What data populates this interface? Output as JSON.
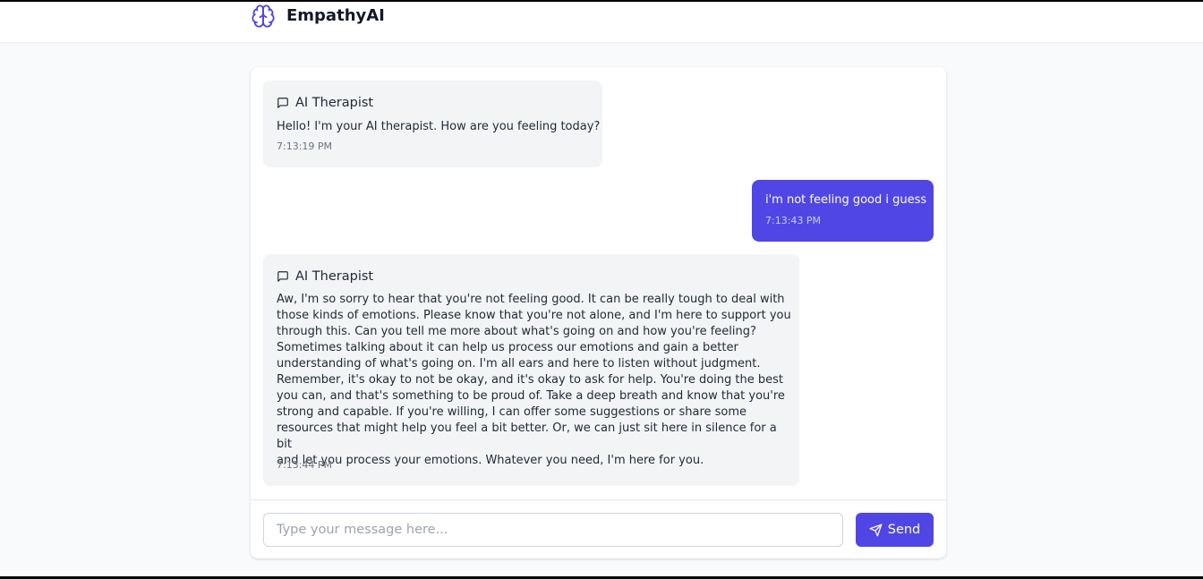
{
  "app": {
    "name": "EmpathyAI",
    "logo_icon": "brain-icon"
  },
  "colors": {
    "accent": "#4f46e5",
    "ai_bubble": "#f3f4f6",
    "page_bg": "#f9fafb"
  },
  "messages": [
    {
      "role": "ai",
      "sender": "AI Therapist",
      "icon": "message-square-icon",
      "text": "Hello! I'm your AI therapist. How are you feeling today?",
      "time": "7:13:19 PM"
    },
    {
      "role": "user",
      "text": "i'm not feeling good i guess",
      "time": "7:13:43 PM"
    },
    {
      "role": "ai",
      "sender": "AI Therapist",
      "icon": "message-square-icon",
      "text": "Aw, I'm so sorry to hear that you're not feeling good. It can be really tough to deal with\nthose kinds of emotions. Please know that you're not alone, and I'm here to support you\nthrough this. Can you tell me more about what's going on and how you're feeling?\nSometimes talking about it can help us process our emotions and gain a better\nunderstanding of what's going on. I'm all ears and here to listen without judgment.\nRemember, it's okay to not be okay, and it's okay to ask for help. You're doing the best\nyou can, and that's something to be proud of. Take a deep breath and know that you're\nstrong and capable. If you're willing, I can offer some suggestions or share some\nresources that might help you feel a bit better. Or, we can just sit here in silence for a bit\nand let you process your emotions. Whatever you need, I'm here for you.",
      "time": "7:13:44 PM"
    }
  ],
  "composer": {
    "value": "",
    "placeholder": "Type your message here...",
    "send_label": "Send",
    "send_icon": "send-icon"
  }
}
